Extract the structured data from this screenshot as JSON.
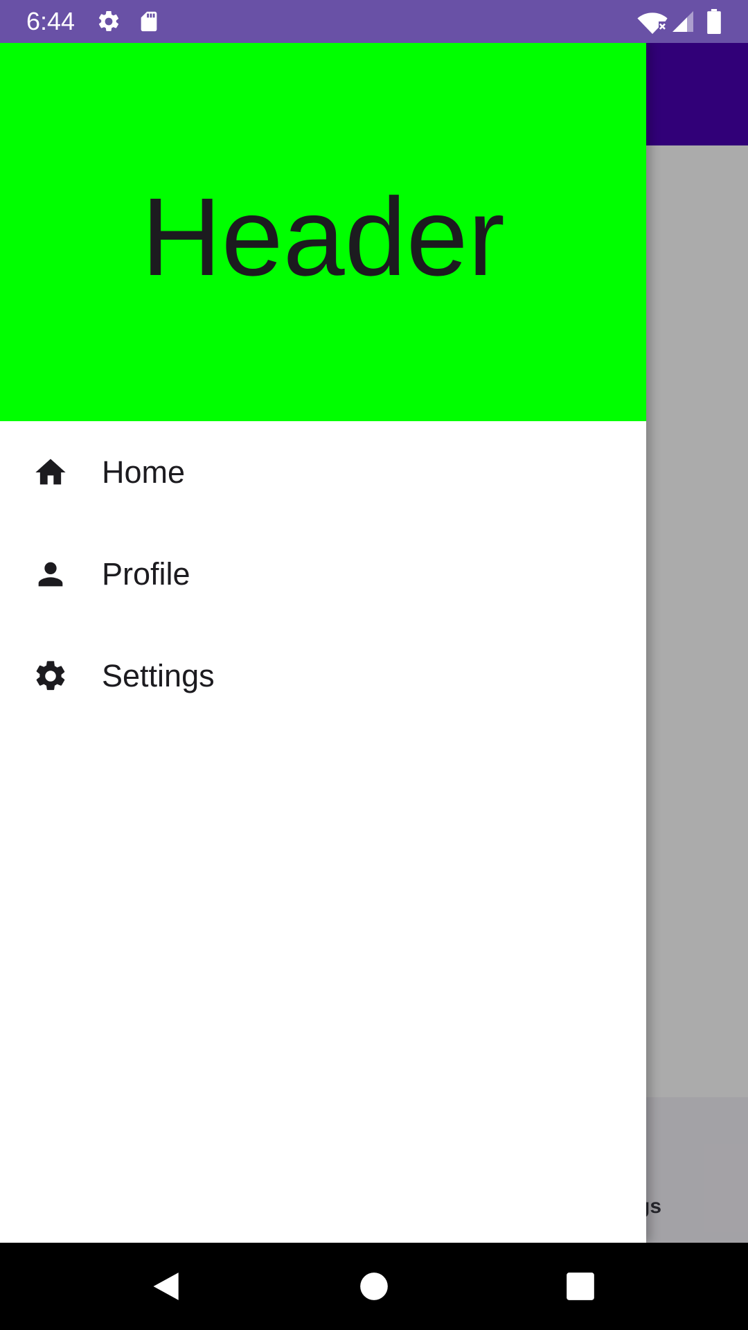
{
  "status_bar": {
    "time": "6:44",
    "icons": [
      "gear-icon",
      "sd-card-icon",
      "wifi-icon",
      "signal-icon",
      "battery-icon"
    ]
  },
  "drawer": {
    "header_title": "Header",
    "items": [
      {
        "label": "Home",
        "icon": "home-icon"
      },
      {
        "label": "Profile",
        "icon": "person-icon"
      },
      {
        "label": "Settings",
        "icon": "gear-icon"
      }
    ]
  },
  "background_app": {
    "bottom_nav_label_partial": "gs"
  },
  "nav_bar": {
    "buttons": [
      "back-icon",
      "home-circle-icon",
      "recents-icon"
    ]
  },
  "colors": {
    "status_bar": "#6951a6",
    "toolbar": "#4a00b3",
    "drawer_header": "#00ff00",
    "text_primary": "#1c1b1f"
  }
}
